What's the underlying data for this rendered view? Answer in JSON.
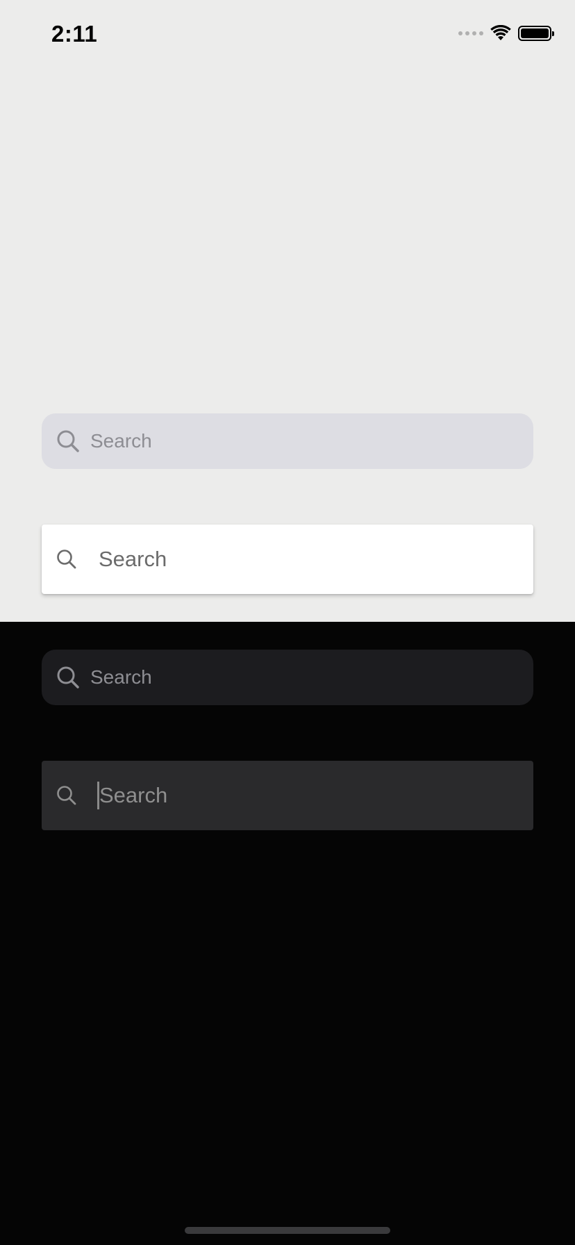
{
  "status_bar": {
    "time": "2:11"
  },
  "colors": {
    "light_background": "#ececeb",
    "dark_background": "#050505",
    "ios_light_search_bg": "#dddde3",
    "ios_dark_search_bg": "#1c1c1f",
    "md_dark_search_bg": "#2a2a2c"
  },
  "searchbars": [
    {
      "style": "ios-light",
      "placeholder": "Search",
      "icon": "search-icon"
    },
    {
      "style": "md-light",
      "placeholder": "Search",
      "icon": "search-icon"
    },
    {
      "style": "ios-dark",
      "placeholder": "Search",
      "icon": "search-icon"
    },
    {
      "style": "md-dark",
      "placeholder": "Search",
      "icon": "search-icon",
      "focused": true
    }
  ]
}
